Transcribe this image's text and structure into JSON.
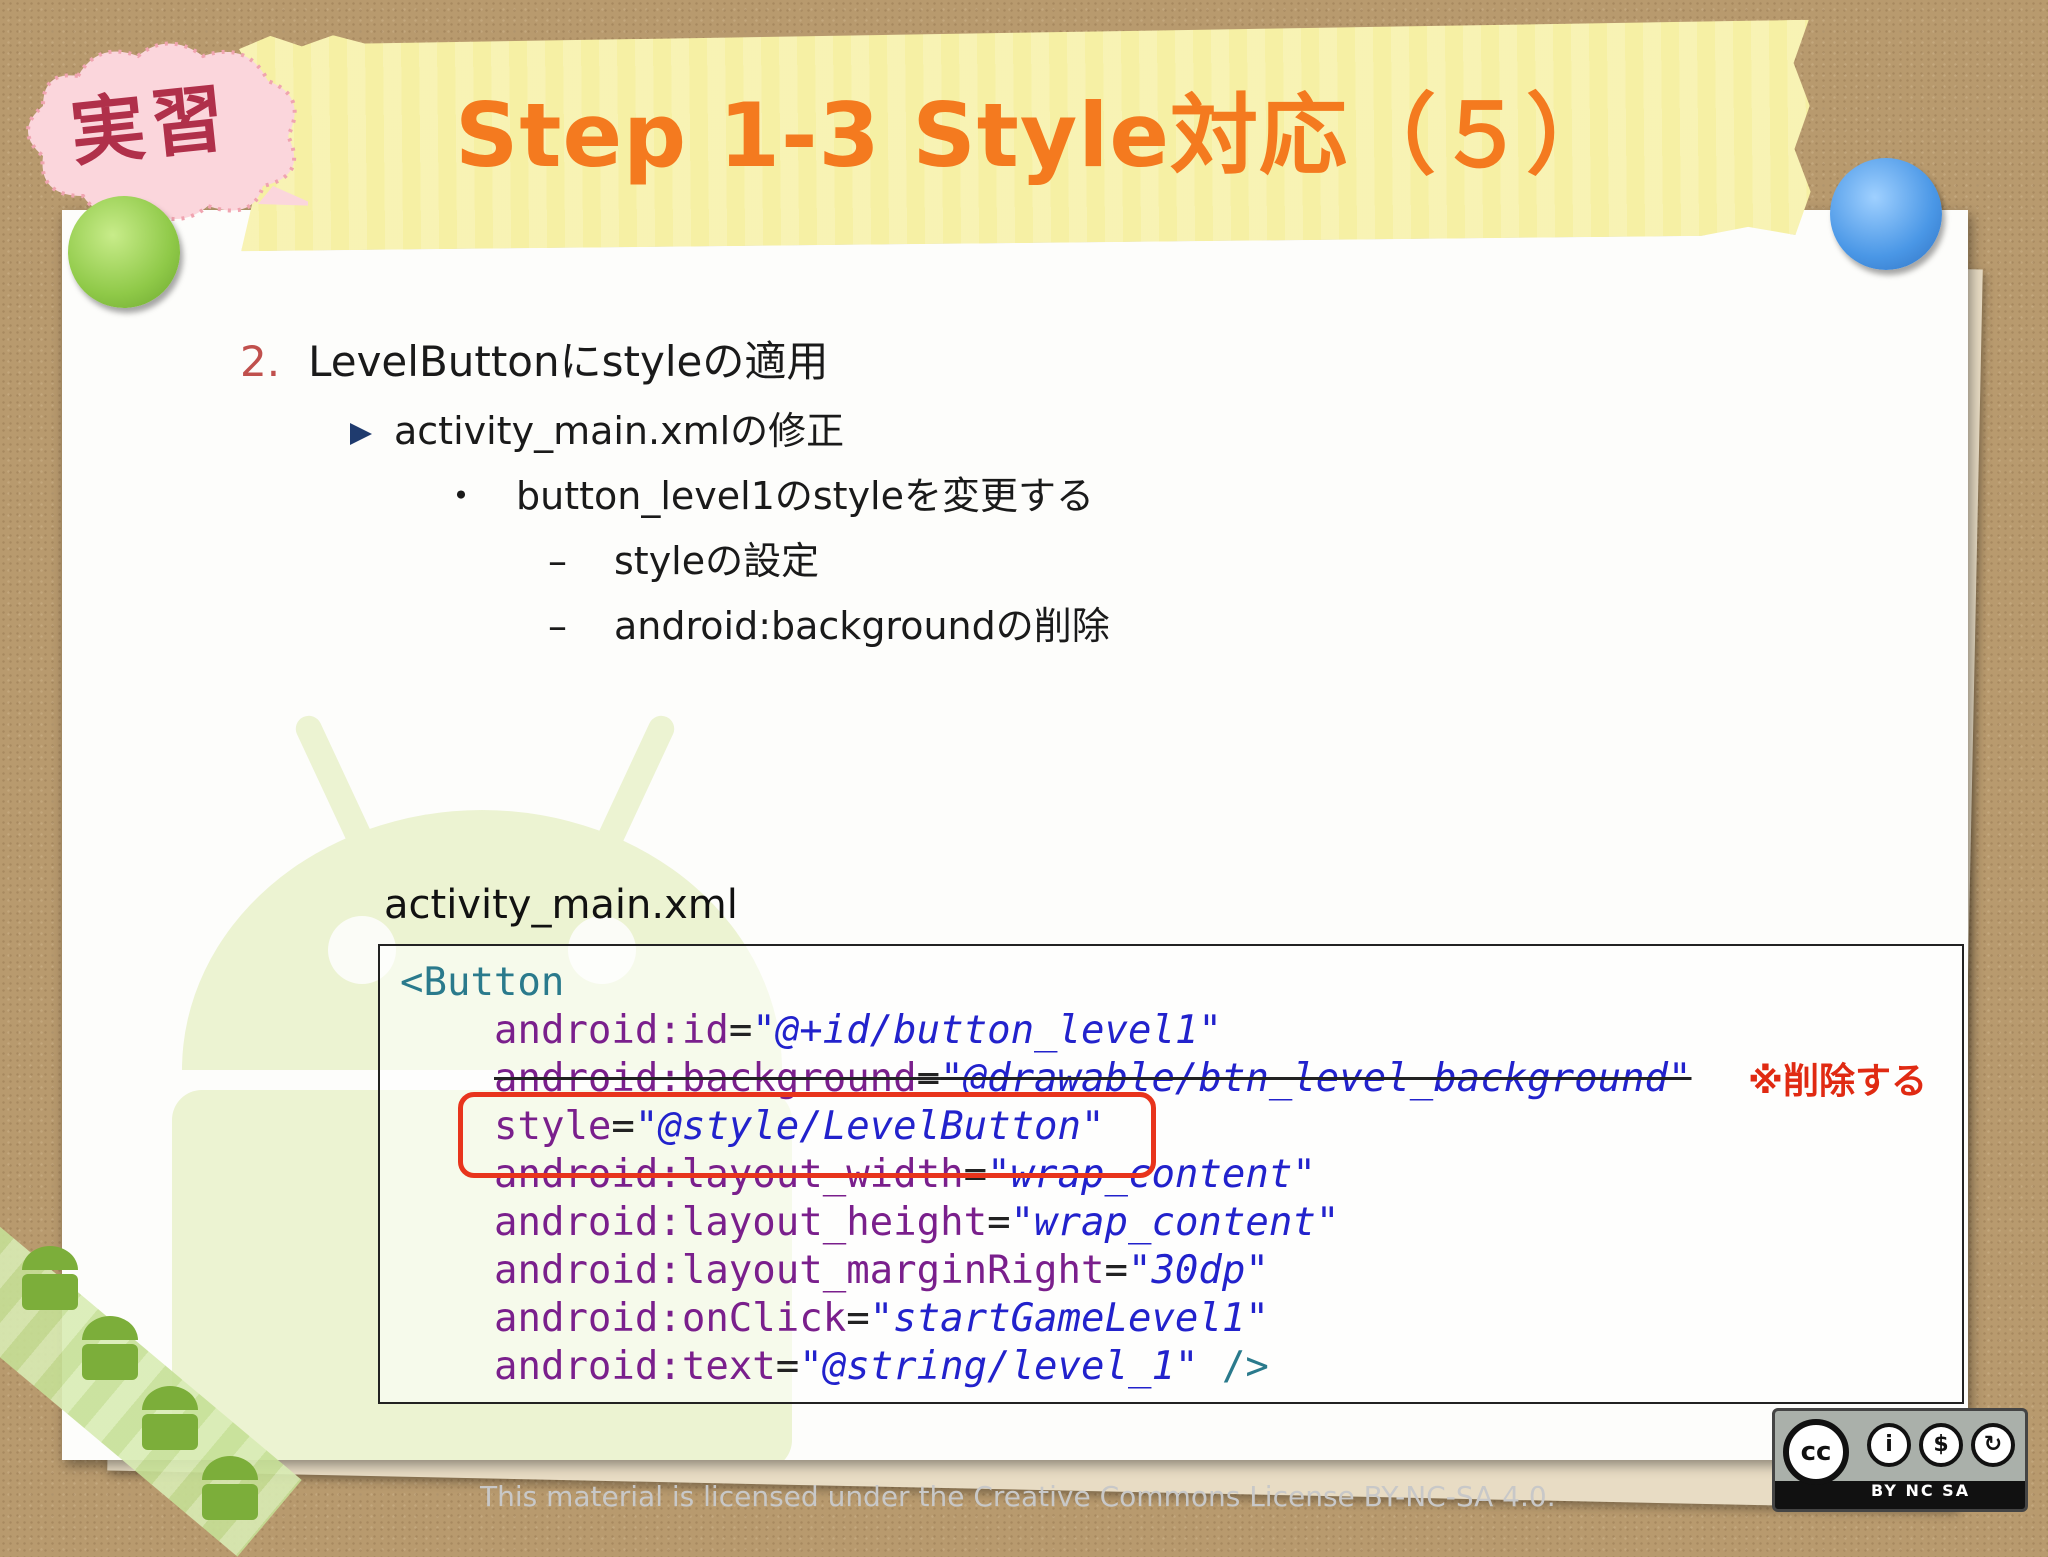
{
  "badge": {
    "label": "実習"
  },
  "slide": {
    "title": "Step 1-3 Style対応（５）"
  },
  "bullets": {
    "l1_number": "2.",
    "l1_text": "LevelButtonにstyleの適用",
    "l2_text": "activity_main.xmlの修正",
    "l3_bullet": "・",
    "l3_text": "button_level1のstyleを変更する",
    "l4_dash": "–",
    "l4_text": "styleの設定",
    "l5_dash": "–",
    "l5_text": "android:backgroundの削除"
  },
  "code": {
    "caption": "activity_main.xml",
    "lines": [
      {
        "open": "<Button"
      },
      {
        "attr": "android:id",
        "eq": "=",
        "val": "\"@+id/button_level1\""
      },
      {
        "attr": "android:background",
        "eq": "=",
        "val": "\"@drawable/btn_level_background\""
      },
      {
        "attr": "style",
        "eq": "=",
        "val": "\"@style/LevelButton\""
      },
      {
        "attr": "android:layout_width",
        "eq": "=",
        "val": "\"wrap_content\""
      },
      {
        "attr": "android:layout_height",
        "eq": "=",
        "val": "\"wrap_content\""
      },
      {
        "attr": "android:layout_marginRight",
        "eq": "=",
        "val": "\"30dp\""
      },
      {
        "attr": "android:onClick",
        "eq": "=",
        "val": "\"startGameLevel1\""
      },
      {
        "attr": "android:text",
        "eq": "=",
        "val": "\"@string/level_1\"",
        "close": " />"
      }
    ],
    "delete_note": "※削除する"
  },
  "footer": {
    "license": "This material is licensed under the Creative Commons License BY-NC-SA 4.0.",
    "cc_main": "cc",
    "cc_labels": "BY NC SA"
  },
  "colors": {
    "title": "#f47a1f",
    "number": "#c0504d",
    "highlight": "#e8341c",
    "code_attr": "#7a1f8c",
    "code_value": "#2222cc",
    "code_tag": "#2a7a8c"
  }
}
